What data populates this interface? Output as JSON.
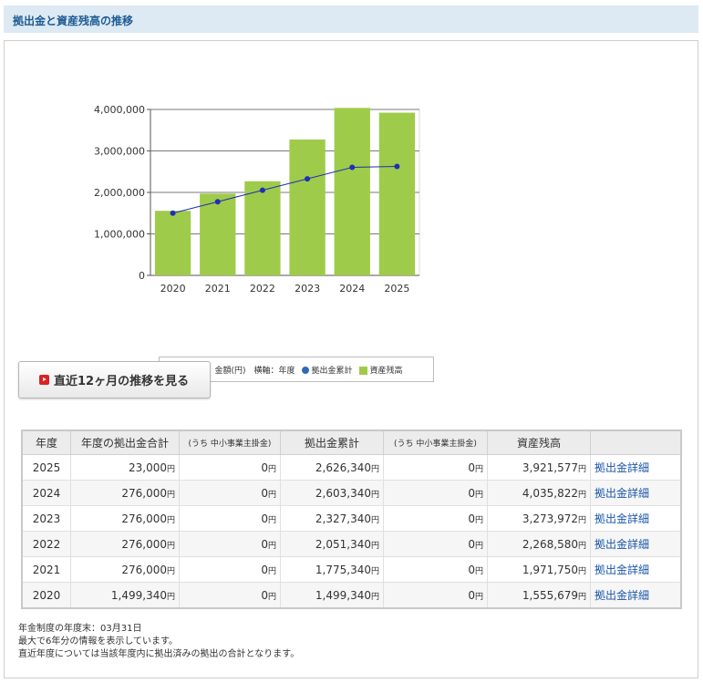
{
  "header": {
    "title": "拠出金と資産残高の推移"
  },
  "chart_data": {
    "type": "bar",
    "categories": [
      "2020",
      "2021",
      "2022",
      "2023",
      "2024",
      "2025"
    ],
    "series": [
      {
        "name": "資産残高",
        "kind": "bar",
        "values": [
          1555679,
          1971750,
          2268580,
          3273972,
          4035822,
          3921577
        ],
        "color": "#9fcb4a"
      },
      {
        "name": "拠出金累計",
        "kind": "line",
        "values": [
          1499340,
          1775340,
          2051340,
          2327340,
          2603340,
          2626340
        ],
        "color": "#1f2fb8"
      }
    ],
    "ylim": [
      0,
      4000000
    ],
    "yticks": [
      "0",
      "1,000,000",
      "2,000,000",
      "3,000,000",
      "4,000,000"
    ],
    "grid": true,
    "legend_position": "bottom"
  },
  "legend": {
    "axis_note": "縦軸：金額(円)　横軸：年度",
    "line_label": "拠出金累計",
    "bar_label": "資産残高"
  },
  "button": {
    "label": "直近12ヶ月の推移を見る"
  },
  "table": {
    "headers": [
      "年度",
      "年度の拠出金合計",
      "(うち 中小事業主掛金)",
      "拠出金累計",
      "(うち 中小事業主掛金)",
      "資産残高",
      ""
    ],
    "unit": "円",
    "rows": [
      {
        "year": "2025",
        "total": "23,000",
        "sme1": "0",
        "cum": "2,626,340",
        "sme2": "0",
        "assets": "3,921,577",
        "link": "拠出金詳細"
      },
      {
        "year": "2024",
        "total": "276,000",
        "sme1": "0",
        "cum": "2,603,340",
        "sme2": "0",
        "assets": "4,035,822",
        "link": "拠出金詳細"
      },
      {
        "year": "2023",
        "total": "276,000",
        "sme1": "0",
        "cum": "2,327,340",
        "sme2": "0",
        "assets": "3,273,972",
        "link": "拠出金詳細"
      },
      {
        "year": "2022",
        "total": "276,000",
        "sme1": "0",
        "cum": "2,051,340",
        "sme2": "0",
        "assets": "2,268,580",
        "link": "拠出金詳細"
      },
      {
        "year": "2021",
        "total": "276,000",
        "sme1": "0",
        "cum": "1,775,340",
        "sme2": "0",
        "assets": "1,971,750",
        "link": "拠出金詳細"
      },
      {
        "year": "2020",
        "total": "1,499,340",
        "sme1": "0",
        "cum": "1,499,340",
        "sme2": "0",
        "assets": "1,555,679",
        "link": "拠出金詳細"
      }
    ]
  },
  "notes": [
    "年金制度の年度末：03月31日",
    "最大で6年分の情報を表示しています。",
    "直近年度については当該年度内に拠出済みの拠出の合計となります。"
  ]
}
